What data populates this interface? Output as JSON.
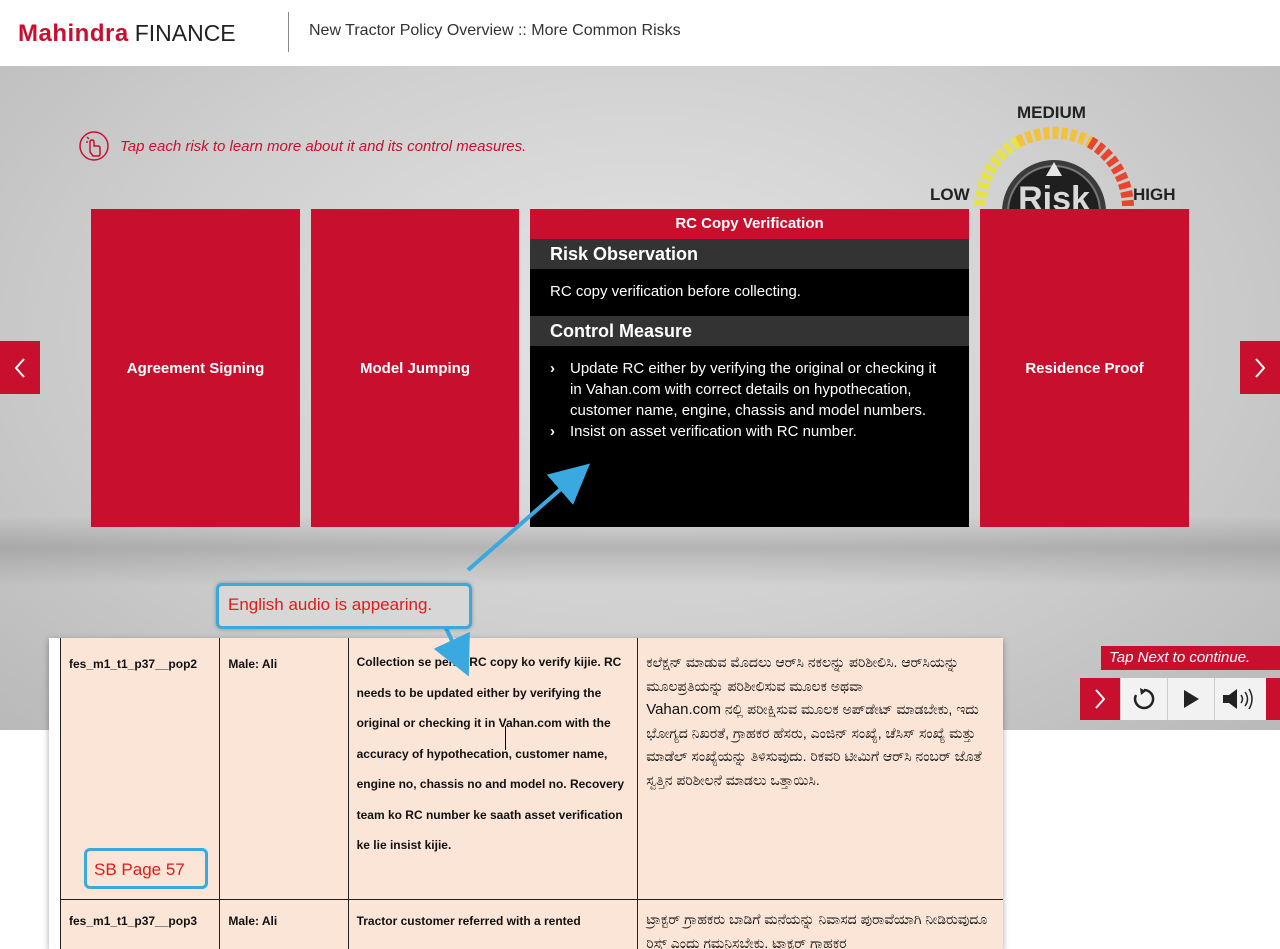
{
  "header": {
    "logo_brand": "Mahindra",
    "logo_finance": "FINANCE",
    "title": "New Tractor Policy Overview :: More Common Risks"
  },
  "instruction": "Tap each risk to learn more about it and its control measures.",
  "gauge": {
    "center_label": "Risk",
    "low": "LOW",
    "medium": "MEDIUM",
    "high": "HIGH"
  },
  "cards": {
    "agreement": "Agreement Signing",
    "model": "Model Jumping",
    "residence": "Residence Proof"
  },
  "open_card": {
    "title": "RC Copy Verification",
    "observation_heading": "Risk Observation",
    "observation_text": "RC copy verification before collecting.",
    "control_heading": "Control Measure",
    "bullets": [
      "Update RC either by verifying the original or checking it in Vahan.com with correct details on hypothecation, customer name, engine, chassis and model numbers.",
      "Insist on asset verification with RC number."
    ]
  },
  "tap_next": "Tap Next to continue.",
  "callout": "English audio is appearing.",
  "sb_page": "SB Page 57",
  "doc_rows": [
    {
      "id": "fes_m1_t1_p37__pop2",
      "voice": "Male: Ali",
      "english": "Collection se pehle RC copy ko verify kijie. RC needs to be updated either by verifying the original or checking it in Vahan.com with the accuracy of hypothecation, customer name, engine no, chassis no and model no. Recovery team ko RC number ke saath asset verification ke lie insist kijie.",
      "kannada_1": "ಕಲೆಕ್ಷನ್ ಮಾಡುವ ಮೊದಲು ಆರ್‌ಸಿ ನಕಲನ್ನು ಪರಿಶೀಲಿಸಿ. ಆರ್‌ಸಿಯನ್ನು ಮೂಲಪ್ರತಿಯನ್ನು ಪರಿಶೀಲಿಸುವ ಮೂಲಕ ಅಥವಾ",
      "kannada_vahan": "Vahan.com",
      "kannada_2": " ನಲ್ಲಿ ಪರೀಕ್ಷಿಸುವ ಮೂಲಕ ಅಪ್‌ಡೇಟ್ ಮಾಡಬೇಕು, ಇದು ಭೋಗ್ಯದ ನಿಖರತೆ, ಗ್ರಾಹಕರ ಹೆಸರು, ಎಂಜಿನ್ ಸಂಖ್ಯೆ, ಚೆಸಿಸ್ ಸಂಖ್ಯೆ ಮತ್ತು ಮಾಡೆಲ್ ಸಂಖ್ಯೆಯನ್ನು ತಿಳಿಸುವುದು. ರಿಕವರಿ ಟೀಮಿಗೆ ಆರ್‌ಸಿ ನಂಬರ್ ಜೊತೆ ಸ್ವತ್ತಿನ ಪರಿಶೀಲನೆ ಮಾಡಲು ಒತ್ತಾಯಿಸಿ."
    },
    {
      "id": "fes_m1_t1_p37__pop3",
      "voice": "Male: Ali",
      "english": "Tractor customer referred with a rented",
      "kannada": "ಟ್ರಾಕ್ಟರ್ ಗ್ರಾಹಕರು ಬಾಡಿಗೆ ಮನೆಯನ್ನು ನಿವಾಸದ ಪುರಾವೆಯಾಗಿ ನೀಡಿರುವುದೂ ರಿಸ್ಕ್ ಎಂದು ಗಮನಿಸಬೇಕು. ಟ್ರಾಕ್ಟರ್ ಗ್ರಾಹಕರ"
    }
  ],
  "colors": {
    "brand_red": "#c8102e",
    "callout_blue": "#39a9e0",
    "doc_bg": "#fbe5d6"
  }
}
